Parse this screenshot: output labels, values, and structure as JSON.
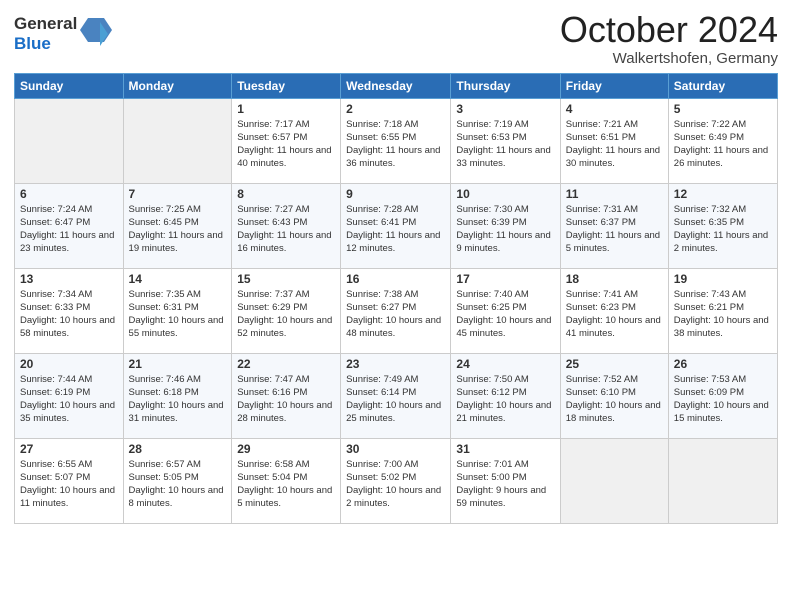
{
  "header": {
    "logo_general": "General",
    "logo_blue": "Blue",
    "month_title": "October 2024",
    "location": "Walkertshofen, Germany"
  },
  "weekdays": [
    "Sunday",
    "Monday",
    "Tuesday",
    "Wednesday",
    "Thursday",
    "Friday",
    "Saturday"
  ],
  "weeks": [
    [
      {
        "day": "",
        "sunrise": "",
        "sunset": "",
        "daylight": ""
      },
      {
        "day": "",
        "sunrise": "",
        "sunset": "",
        "daylight": ""
      },
      {
        "day": "1",
        "sunrise": "Sunrise: 7:17 AM",
        "sunset": "Sunset: 6:57 PM",
        "daylight": "Daylight: 11 hours and 40 minutes."
      },
      {
        "day": "2",
        "sunrise": "Sunrise: 7:18 AM",
        "sunset": "Sunset: 6:55 PM",
        "daylight": "Daylight: 11 hours and 36 minutes."
      },
      {
        "day": "3",
        "sunrise": "Sunrise: 7:19 AM",
        "sunset": "Sunset: 6:53 PM",
        "daylight": "Daylight: 11 hours and 33 minutes."
      },
      {
        "day": "4",
        "sunrise": "Sunrise: 7:21 AM",
        "sunset": "Sunset: 6:51 PM",
        "daylight": "Daylight: 11 hours and 30 minutes."
      },
      {
        "day": "5",
        "sunrise": "Sunrise: 7:22 AM",
        "sunset": "Sunset: 6:49 PM",
        "daylight": "Daylight: 11 hours and 26 minutes."
      }
    ],
    [
      {
        "day": "6",
        "sunrise": "Sunrise: 7:24 AM",
        "sunset": "Sunset: 6:47 PM",
        "daylight": "Daylight: 11 hours and 23 minutes."
      },
      {
        "day": "7",
        "sunrise": "Sunrise: 7:25 AM",
        "sunset": "Sunset: 6:45 PM",
        "daylight": "Daylight: 11 hours and 19 minutes."
      },
      {
        "day": "8",
        "sunrise": "Sunrise: 7:27 AM",
        "sunset": "Sunset: 6:43 PM",
        "daylight": "Daylight: 11 hours and 16 minutes."
      },
      {
        "day": "9",
        "sunrise": "Sunrise: 7:28 AM",
        "sunset": "Sunset: 6:41 PM",
        "daylight": "Daylight: 11 hours and 12 minutes."
      },
      {
        "day": "10",
        "sunrise": "Sunrise: 7:30 AM",
        "sunset": "Sunset: 6:39 PM",
        "daylight": "Daylight: 11 hours and 9 minutes."
      },
      {
        "day": "11",
        "sunrise": "Sunrise: 7:31 AM",
        "sunset": "Sunset: 6:37 PM",
        "daylight": "Daylight: 11 hours and 5 minutes."
      },
      {
        "day": "12",
        "sunrise": "Sunrise: 7:32 AM",
        "sunset": "Sunset: 6:35 PM",
        "daylight": "Daylight: 11 hours and 2 minutes."
      }
    ],
    [
      {
        "day": "13",
        "sunrise": "Sunrise: 7:34 AM",
        "sunset": "Sunset: 6:33 PM",
        "daylight": "Daylight: 10 hours and 58 minutes."
      },
      {
        "day": "14",
        "sunrise": "Sunrise: 7:35 AM",
        "sunset": "Sunset: 6:31 PM",
        "daylight": "Daylight: 10 hours and 55 minutes."
      },
      {
        "day": "15",
        "sunrise": "Sunrise: 7:37 AM",
        "sunset": "Sunset: 6:29 PM",
        "daylight": "Daylight: 10 hours and 52 minutes."
      },
      {
        "day": "16",
        "sunrise": "Sunrise: 7:38 AM",
        "sunset": "Sunset: 6:27 PM",
        "daylight": "Daylight: 10 hours and 48 minutes."
      },
      {
        "day": "17",
        "sunrise": "Sunrise: 7:40 AM",
        "sunset": "Sunset: 6:25 PM",
        "daylight": "Daylight: 10 hours and 45 minutes."
      },
      {
        "day": "18",
        "sunrise": "Sunrise: 7:41 AM",
        "sunset": "Sunset: 6:23 PM",
        "daylight": "Daylight: 10 hours and 41 minutes."
      },
      {
        "day": "19",
        "sunrise": "Sunrise: 7:43 AM",
        "sunset": "Sunset: 6:21 PM",
        "daylight": "Daylight: 10 hours and 38 minutes."
      }
    ],
    [
      {
        "day": "20",
        "sunrise": "Sunrise: 7:44 AM",
        "sunset": "Sunset: 6:19 PM",
        "daylight": "Daylight: 10 hours and 35 minutes."
      },
      {
        "day": "21",
        "sunrise": "Sunrise: 7:46 AM",
        "sunset": "Sunset: 6:18 PM",
        "daylight": "Daylight: 10 hours and 31 minutes."
      },
      {
        "day": "22",
        "sunrise": "Sunrise: 7:47 AM",
        "sunset": "Sunset: 6:16 PM",
        "daylight": "Daylight: 10 hours and 28 minutes."
      },
      {
        "day": "23",
        "sunrise": "Sunrise: 7:49 AM",
        "sunset": "Sunset: 6:14 PM",
        "daylight": "Daylight: 10 hours and 25 minutes."
      },
      {
        "day": "24",
        "sunrise": "Sunrise: 7:50 AM",
        "sunset": "Sunset: 6:12 PM",
        "daylight": "Daylight: 10 hours and 21 minutes."
      },
      {
        "day": "25",
        "sunrise": "Sunrise: 7:52 AM",
        "sunset": "Sunset: 6:10 PM",
        "daylight": "Daylight: 10 hours and 18 minutes."
      },
      {
        "day": "26",
        "sunrise": "Sunrise: 7:53 AM",
        "sunset": "Sunset: 6:09 PM",
        "daylight": "Daylight: 10 hours and 15 minutes."
      }
    ],
    [
      {
        "day": "27",
        "sunrise": "Sunrise: 6:55 AM",
        "sunset": "Sunset: 5:07 PM",
        "daylight": "Daylight: 10 hours and 11 minutes."
      },
      {
        "day": "28",
        "sunrise": "Sunrise: 6:57 AM",
        "sunset": "Sunset: 5:05 PM",
        "daylight": "Daylight: 10 hours and 8 minutes."
      },
      {
        "day": "29",
        "sunrise": "Sunrise: 6:58 AM",
        "sunset": "Sunset: 5:04 PM",
        "daylight": "Daylight: 10 hours and 5 minutes."
      },
      {
        "day": "30",
        "sunrise": "Sunrise: 7:00 AM",
        "sunset": "Sunset: 5:02 PM",
        "daylight": "Daylight: 10 hours and 2 minutes."
      },
      {
        "day": "31",
        "sunrise": "Sunrise: 7:01 AM",
        "sunset": "Sunset: 5:00 PM",
        "daylight": "Daylight: 9 hours and 59 minutes."
      },
      {
        "day": "",
        "sunrise": "",
        "sunset": "",
        "daylight": ""
      },
      {
        "day": "",
        "sunrise": "",
        "sunset": "",
        "daylight": ""
      }
    ]
  ]
}
